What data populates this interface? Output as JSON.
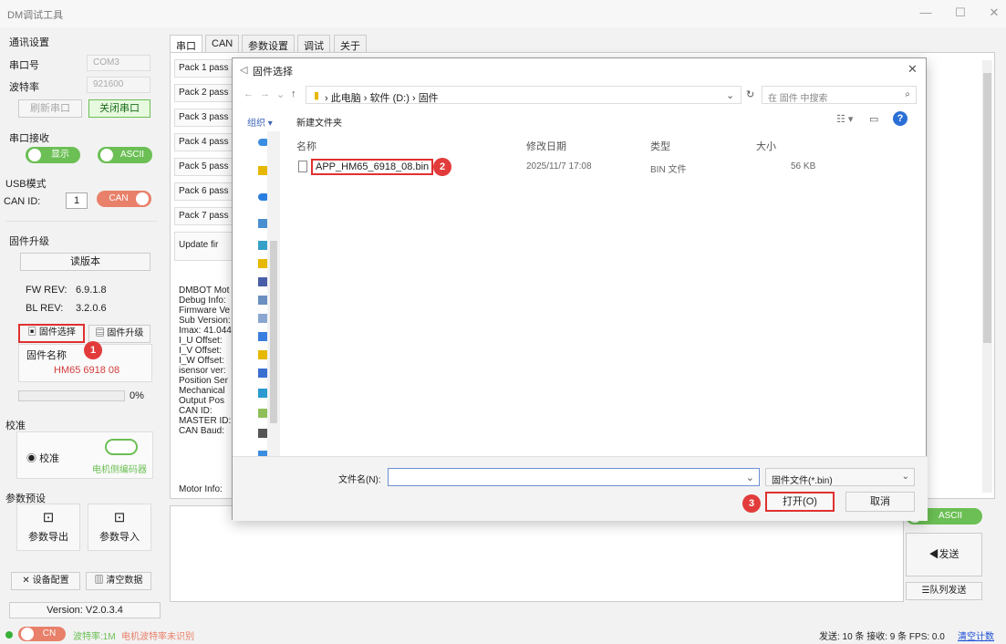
{
  "window": {
    "title": "DM调试工具",
    "min": "—",
    "max": "☐",
    "close": "✕"
  },
  "left": {
    "comm_title": "通讯设置",
    "port_label": "串口号",
    "port_value": "COM3",
    "baud_label": "波特率",
    "baud_value": "921600",
    "refresh_btn": "刷新串口",
    "close_port_btn": "关闭串口",
    "rx_title": "串口接收",
    "display_toggle": "显示",
    "ascii_toggle": "ASCII",
    "usb_title": "USB模式",
    "canid_label": "CAN ID:",
    "canid_value": "1",
    "can_toggle": "CAN",
    "fw_title": "固件升级",
    "read_version_btn": "读版本",
    "fw_rev_label": "FW REV:",
    "fw_rev_value": "6.9.1.8",
    "bl_rev_label": "BL REV:",
    "bl_rev_value": "3.2.0.6",
    "select_fw_btn": "固件选择",
    "upgrade_fw_btn": "固件升级",
    "fw_name_label": "固件名称",
    "fw_name_value": "HM65 6918 08",
    "progress_text": "0%",
    "progress_value": 0,
    "calib_title": "校准",
    "calib_radio": "校准",
    "motor_encoder": "电机侧编码器",
    "preset_title": "参数预设",
    "export_btn": "参数导出",
    "import_btn": "参数导入",
    "device_config_btn": "设备配置",
    "clear_data_btn": "清空数据",
    "version": "Version: V2.0.3.4"
  },
  "tabs": [
    "串口",
    "CAN",
    "参数设置",
    "调试",
    "关于"
  ],
  "packs": [
    "Pack 1 pass",
    "Pack 2 pass",
    "Pack 3 pass",
    "Pack 4 pass",
    "Pack 5 pass",
    "Pack 6 pass",
    "Pack 7 pass"
  ],
  "update_line": "Update fir",
  "log_lines": [
    "DMBOT Mot",
    "Debug Info:",
    "Firmware Ve",
    "Sub Version:",
    "Imax: 41.044",
    "I_U Offset:",
    "I_V Offset:",
    "I_W Offset:",
    "isensor ver:",
    "Position Ser",
    "Mechanical",
    "Output Pos",
    "CAN ID:",
    "MASTER ID:",
    "CAN Baud:"
  ],
  "motor_info": "Motor Info:",
  "dialog": {
    "title": "固件选择",
    "path": [
      "此电脑",
      "软件 (D:)",
      "固件"
    ],
    "search_placeholder": "在 固件 中搜索",
    "organize": "组织 ▾",
    "new_folder": "新建文件夹",
    "col_name": "名称",
    "col_date": "修改日期",
    "col_type": "类型",
    "col_size": "大小",
    "file": {
      "name": "APP_HM65_6918_08.bin",
      "date": "2025/11/7 17:08",
      "type": "BIN 文件",
      "size": "56 KB"
    },
    "filename_label": "文件名(N):",
    "filename_value": "",
    "filter": "固件文件(*.bin)",
    "open_btn": "打开(O)",
    "cancel_btn": "取消"
  },
  "markers": [
    "1",
    "2",
    "3"
  ],
  "right_bottom": {
    "ascii_toggle": "ASCII",
    "send_btn": "发送",
    "queue_btn": "队列发送"
  },
  "status": {
    "can_toggle": "CN",
    "baud": "波特率:1M",
    "motor_baud": "电机波特率未识别",
    "stats": "发送: 10 条  接收: 9 条  FPS: 0.0",
    "clear_count": "清空计数"
  },
  "colors": {
    "accent_green": "#6bbf54",
    "marker_red": "#e23b3b",
    "can_orange": "#e9806a",
    "link_blue": "#1a4fd6"
  }
}
